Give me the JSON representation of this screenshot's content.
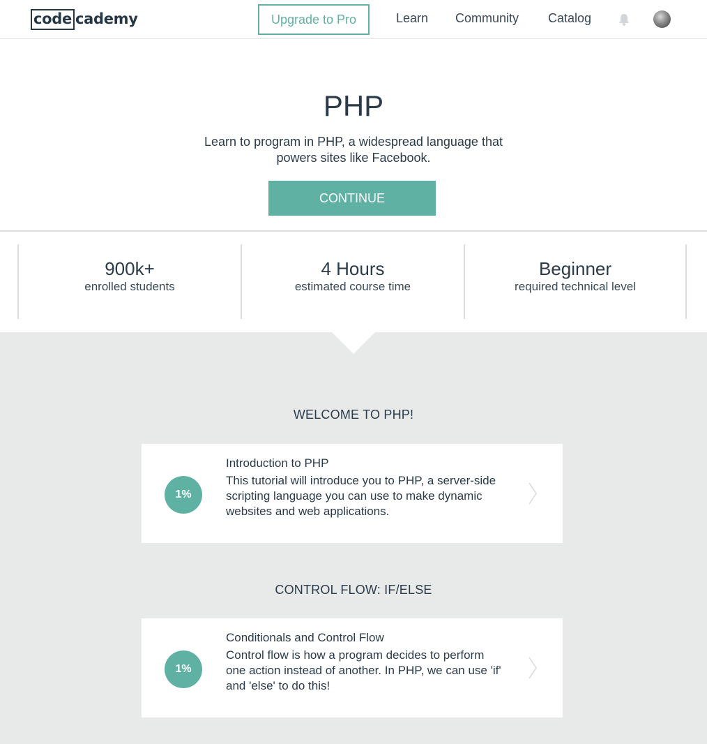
{
  "navbar": {
    "logo_box": "code",
    "logo_rest": "cademy",
    "upgrade_label": "Upgrade to Pro",
    "links": {
      "learn": "Learn",
      "community": "Community",
      "catalog": "Catalog"
    },
    "icons": [
      "bell-icon",
      "avatar"
    ]
  },
  "hero": {
    "title": "PHP",
    "description": "Learn to program in PHP, a widespread language that powers sites like Facebook.",
    "continue_label": "CONTINUE"
  },
  "stats": [
    {
      "value": "900k+",
      "label": "enrolled students"
    },
    {
      "value": "4 Hours",
      "label": "estimated course time"
    },
    {
      "value": "Beginner",
      "label": "required technical level"
    }
  ],
  "sections": [
    {
      "title": "WELCOME TO PHP!",
      "card": {
        "progress": "1%",
        "title": "Introduction to PHP",
        "description": "This tutorial will introduce you to PHP, a server-side scripting language you can use to make dynamic websites and web applications."
      }
    },
    {
      "title": "CONTROL FLOW: IF/ELSE",
      "card": {
        "progress": "1%",
        "title": "Conditionals and Control Flow",
        "description": "Control flow is how a program decides to perform one action instead of another. In PHP, we can use 'if' and 'else' to do this!"
      }
    }
  ],
  "colors": {
    "accent": "#5fb2a3",
    "text": "#2b3b4a",
    "grey_background": "#e8e9e9"
  }
}
